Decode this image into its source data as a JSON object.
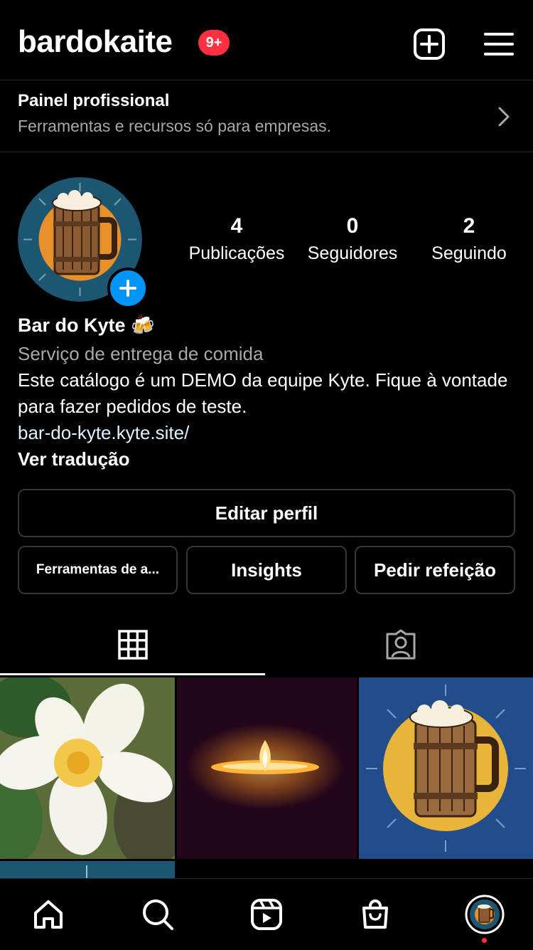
{
  "header": {
    "username": "bardokaite",
    "notification_badge": "9+",
    "create_icon": "plus-square-icon",
    "menu_icon": "hamburger-menu-icon"
  },
  "professional_panel": {
    "title": "Painel profissional",
    "subtitle": "Ferramentas e recursos só para empresas.",
    "icon": "chevron-right-icon"
  },
  "profile": {
    "stats": [
      {
        "value": "4",
        "label": "Publicações"
      },
      {
        "value": "0",
        "label": "Seguidores"
      },
      {
        "value": "2",
        "label": "Seguindo"
      }
    ],
    "name": "Bar do Kyte 🍻",
    "category": "Serviço de entrega de comida",
    "description": "Este catálogo é um DEMO da equipe Kyte. Fique à vontade para fazer pedidos de teste.",
    "link": "bar-do-kyte.kyte.site/",
    "translate_label": "Ver tradução"
  },
  "actions": {
    "edit_profile": "Editar perfil",
    "tools": "Ferramentas de a...",
    "insights": "Insights",
    "order_food": "Pedir refeição"
  },
  "tabs": [
    {
      "icon": "grid-icon",
      "active": true
    },
    {
      "icon": "tagged-person-icon",
      "active": false
    }
  ],
  "grid_posts": [
    {
      "subject": "plumeria-flower"
    },
    {
      "subject": "candle-flame"
    },
    {
      "subject": "beer-mug"
    },
    {
      "subject": "beer-mug-partial"
    }
  ],
  "bottom_nav": [
    {
      "icon": "home-icon"
    },
    {
      "icon": "search-icon"
    },
    {
      "icon": "reels-icon"
    },
    {
      "icon": "shop-bag-icon"
    },
    {
      "icon": "profile-avatar-icon"
    }
  ],
  "colors": {
    "background": "#000000",
    "secondary_text": "#a8a8a8",
    "link": "#e0f1ff",
    "badge_red": "#ff3040",
    "accent_blue": "#0095f6",
    "button_border": "#363636",
    "divider": "#262626"
  }
}
